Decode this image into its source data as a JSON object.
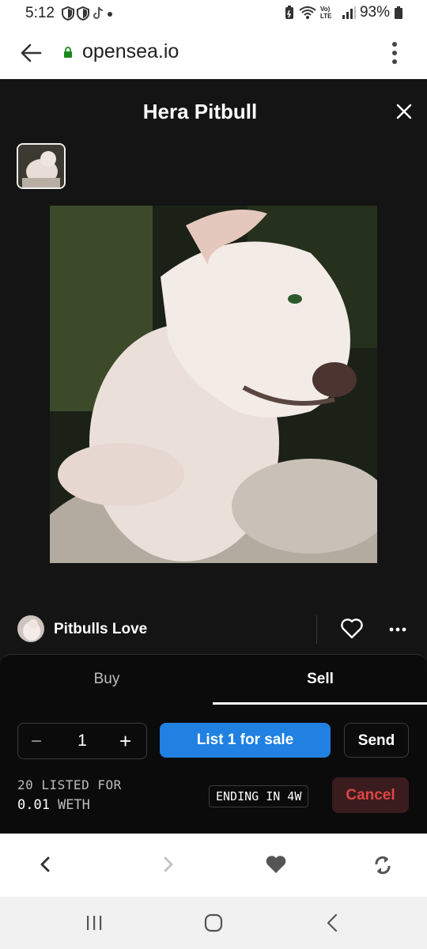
{
  "status_bar": {
    "time": "5:12",
    "signal_label": "Vo)\nLTE",
    "battery": "93%"
  },
  "browser": {
    "url": "opensea.io",
    "icons": [
      "back-arrow-icon",
      "lock-icon",
      "menu-dots-icon"
    ]
  },
  "modal": {
    "title": "Hera Pitbull",
    "owner": "Pitbulls Love",
    "tabs": [
      {
        "label": "Buy",
        "active": false
      },
      {
        "label": "Sell",
        "active": true
      }
    ],
    "quantity": "1",
    "list_button": "List 1 for sale",
    "send_button": "Send",
    "listed_text": "20 LISTED FOR",
    "price": "0.01",
    "currency": "WETH",
    "ending_badge": "ENDING IN 4W",
    "cancel_button": "Cancel"
  },
  "colors": {
    "modal_bg": "#141414",
    "accent_blue": "#2081e2",
    "cancel_red": "#e04545"
  },
  "bottom_nav": {
    "icons": [
      "back-icon",
      "forward-icon",
      "heart-icon",
      "refresh-icon"
    ]
  },
  "android_nav": {
    "icons": [
      "recents-icon",
      "home-icon",
      "back-icon"
    ]
  }
}
